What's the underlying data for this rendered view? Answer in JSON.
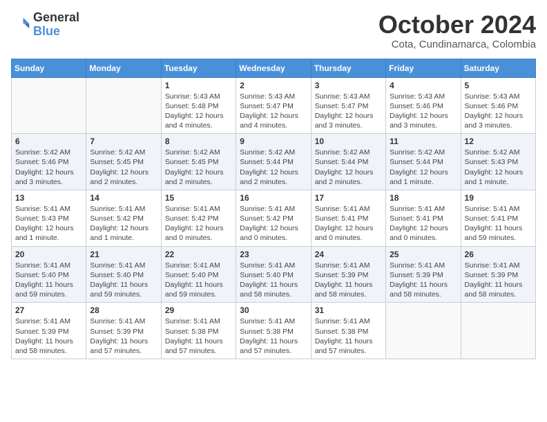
{
  "header": {
    "logo_general": "General",
    "logo_blue": "Blue",
    "title": "October 2024",
    "subtitle": "Cota, Cundinamarca, Colombia"
  },
  "columns": [
    "Sunday",
    "Monday",
    "Tuesday",
    "Wednesday",
    "Thursday",
    "Friday",
    "Saturday"
  ],
  "weeks": [
    [
      {
        "day": "",
        "info": ""
      },
      {
        "day": "",
        "info": ""
      },
      {
        "day": "1",
        "info": "Sunrise: 5:43 AM\nSunset: 5:48 PM\nDaylight: 12 hours\nand 4 minutes."
      },
      {
        "day": "2",
        "info": "Sunrise: 5:43 AM\nSunset: 5:47 PM\nDaylight: 12 hours\nand 4 minutes."
      },
      {
        "day": "3",
        "info": "Sunrise: 5:43 AM\nSunset: 5:47 PM\nDaylight: 12 hours\nand 3 minutes."
      },
      {
        "day": "4",
        "info": "Sunrise: 5:43 AM\nSunset: 5:46 PM\nDaylight: 12 hours\nand 3 minutes."
      },
      {
        "day": "5",
        "info": "Sunrise: 5:43 AM\nSunset: 5:46 PM\nDaylight: 12 hours\nand 3 minutes."
      }
    ],
    [
      {
        "day": "6",
        "info": "Sunrise: 5:42 AM\nSunset: 5:46 PM\nDaylight: 12 hours\nand 3 minutes."
      },
      {
        "day": "7",
        "info": "Sunrise: 5:42 AM\nSunset: 5:45 PM\nDaylight: 12 hours\nand 2 minutes."
      },
      {
        "day": "8",
        "info": "Sunrise: 5:42 AM\nSunset: 5:45 PM\nDaylight: 12 hours\nand 2 minutes."
      },
      {
        "day": "9",
        "info": "Sunrise: 5:42 AM\nSunset: 5:44 PM\nDaylight: 12 hours\nand 2 minutes."
      },
      {
        "day": "10",
        "info": "Sunrise: 5:42 AM\nSunset: 5:44 PM\nDaylight: 12 hours\nand 2 minutes."
      },
      {
        "day": "11",
        "info": "Sunrise: 5:42 AM\nSunset: 5:44 PM\nDaylight: 12 hours\nand 1 minute."
      },
      {
        "day": "12",
        "info": "Sunrise: 5:42 AM\nSunset: 5:43 PM\nDaylight: 12 hours\nand 1 minute."
      }
    ],
    [
      {
        "day": "13",
        "info": "Sunrise: 5:41 AM\nSunset: 5:43 PM\nDaylight: 12 hours\nand 1 minute."
      },
      {
        "day": "14",
        "info": "Sunrise: 5:41 AM\nSunset: 5:42 PM\nDaylight: 12 hours\nand 1 minute."
      },
      {
        "day": "15",
        "info": "Sunrise: 5:41 AM\nSunset: 5:42 PM\nDaylight: 12 hours\nand 0 minutes."
      },
      {
        "day": "16",
        "info": "Sunrise: 5:41 AM\nSunset: 5:42 PM\nDaylight: 12 hours\nand 0 minutes."
      },
      {
        "day": "17",
        "info": "Sunrise: 5:41 AM\nSunset: 5:41 PM\nDaylight: 12 hours\nand 0 minutes."
      },
      {
        "day": "18",
        "info": "Sunrise: 5:41 AM\nSunset: 5:41 PM\nDaylight: 12 hours\nand 0 minutes."
      },
      {
        "day": "19",
        "info": "Sunrise: 5:41 AM\nSunset: 5:41 PM\nDaylight: 11 hours\nand 59 minutes."
      }
    ],
    [
      {
        "day": "20",
        "info": "Sunrise: 5:41 AM\nSunset: 5:40 PM\nDaylight: 11 hours\nand 59 minutes."
      },
      {
        "day": "21",
        "info": "Sunrise: 5:41 AM\nSunset: 5:40 PM\nDaylight: 11 hours\nand 59 minutes."
      },
      {
        "day": "22",
        "info": "Sunrise: 5:41 AM\nSunset: 5:40 PM\nDaylight: 11 hours\nand 59 minutes."
      },
      {
        "day": "23",
        "info": "Sunrise: 5:41 AM\nSunset: 5:40 PM\nDaylight: 11 hours\nand 58 minutes."
      },
      {
        "day": "24",
        "info": "Sunrise: 5:41 AM\nSunset: 5:39 PM\nDaylight: 11 hours\nand 58 minutes."
      },
      {
        "day": "25",
        "info": "Sunrise: 5:41 AM\nSunset: 5:39 PM\nDaylight: 11 hours\nand 58 minutes."
      },
      {
        "day": "26",
        "info": "Sunrise: 5:41 AM\nSunset: 5:39 PM\nDaylight: 11 hours\nand 58 minutes."
      }
    ],
    [
      {
        "day": "27",
        "info": "Sunrise: 5:41 AM\nSunset: 5:39 PM\nDaylight: 11 hours\nand 58 minutes."
      },
      {
        "day": "28",
        "info": "Sunrise: 5:41 AM\nSunset: 5:39 PM\nDaylight: 11 hours\nand 57 minutes."
      },
      {
        "day": "29",
        "info": "Sunrise: 5:41 AM\nSunset: 5:38 PM\nDaylight: 11 hours\nand 57 minutes."
      },
      {
        "day": "30",
        "info": "Sunrise: 5:41 AM\nSunset: 5:38 PM\nDaylight: 11 hours\nand 57 minutes."
      },
      {
        "day": "31",
        "info": "Sunrise: 5:41 AM\nSunset: 5:38 PM\nDaylight: 11 hours\nand 57 minutes."
      },
      {
        "day": "",
        "info": ""
      },
      {
        "day": "",
        "info": ""
      }
    ]
  ]
}
